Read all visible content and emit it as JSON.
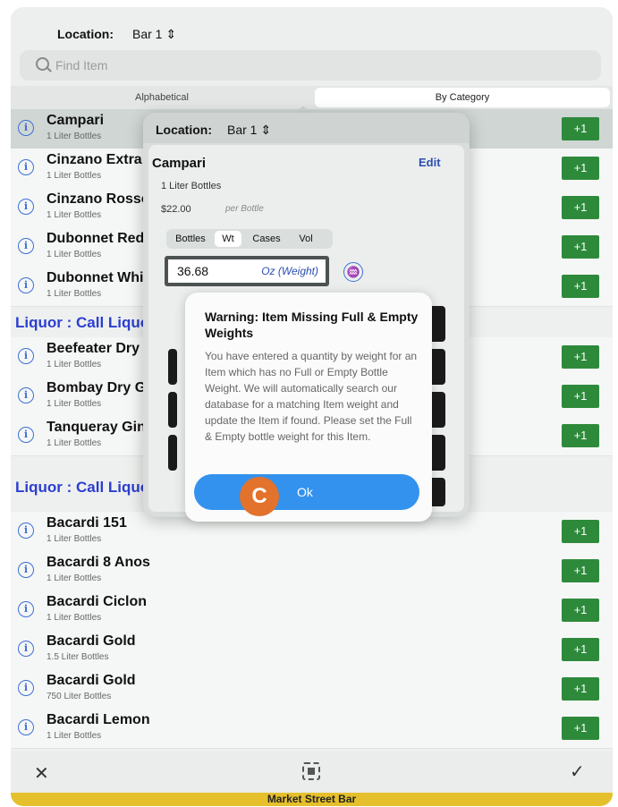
{
  "header": {
    "location_label": "Location:",
    "location_value": "Bar 1"
  },
  "search": {
    "placeholder": "Find Item"
  },
  "tabs": {
    "alphabetical": "Alphabetical",
    "by_category": "By Category"
  },
  "rows": [
    {
      "name": "Campari",
      "size": "1 Liter Bottles",
      "action": "+1"
    },
    {
      "name": "Cinzano Extra D",
      "size": "1 Liter Bottles",
      "action": "+1"
    },
    {
      "name": "Cinzano Rosso",
      "size": "1 Liter Bottles",
      "action": "+1"
    },
    {
      "name": "Dubonnet Red",
      "size": "1 Liter Bottles",
      "action": "+1"
    },
    {
      "name": "Dubonnet Whit",
      "size": "1 Liter Bottles",
      "action": "+1"
    },
    {
      "name": "Beefeater Dry C",
      "size": "1 Liter Bottles",
      "action": "+1"
    },
    {
      "name": "Bombay Dry Gi",
      "size": "1 Liter Bottles",
      "action": "+1"
    },
    {
      "name": "Tanqueray Gin",
      "size": "1 Liter Bottles",
      "action": "+1"
    },
    {
      "name": "Bacardi 151",
      "size": "1 Liter Bottles",
      "action": "+1"
    },
    {
      "name": "Bacardi 8 Anos",
      "size": "1 Liter Bottles",
      "action": "+1"
    },
    {
      "name": "Bacardi Ciclon",
      "size": "1 Liter Bottles",
      "action": "+1"
    },
    {
      "name": "Bacardi Gold",
      "size": "1.5 Liter Bottles",
      "action": "+1"
    },
    {
      "name": "Bacardi Gold",
      "size": "750 Liter Bottles",
      "action": "+1"
    },
    {
      "name": "Bacardi Lemon",
      "size": "1 Liter Bottles",
      "action": "+1"
    }
  ],
  "sections": [
    "Liquor : Call Liquo",
    "Liquor : Call Liquo"
  ],
  "popover": {
    "location_label": "Location:",
    "location_value": "Bar 1",
    "item_name": "Campari",
    "edit": "Edit",
    "size": "1 Liter Bottles",
    "price": "$22.00",
    "price_unit": "per Bottle",
    "count_tabs": [
      "Bottles",
      "Wt",
      "Cases",
      "Vol"
    ],
    "quantity": "36.68",
    "unit": "Oz (Weight)"
  },
  "alert": {
    "title": "Warning: Item Missing Full & Empty Weights",
    "message": "You have entered a quantity by weight for an Item which has no Full or Empty Bottle Weight. We will automatically search our database for a matching Item weight and update the Item if found. Please set the Full & Empty bottle weight for this Item.",
    "ok": "Ok"
  },
  "callout": "C",
  "footer": "Market Street Bar",
  "colors": {
    "accent": "#3392ee",
    "plus": "#2e8a3b",
    "section": "#2c3ed0",
    "footer": "#e6c02c",
    "callout": "#e2722c"
  }
}
